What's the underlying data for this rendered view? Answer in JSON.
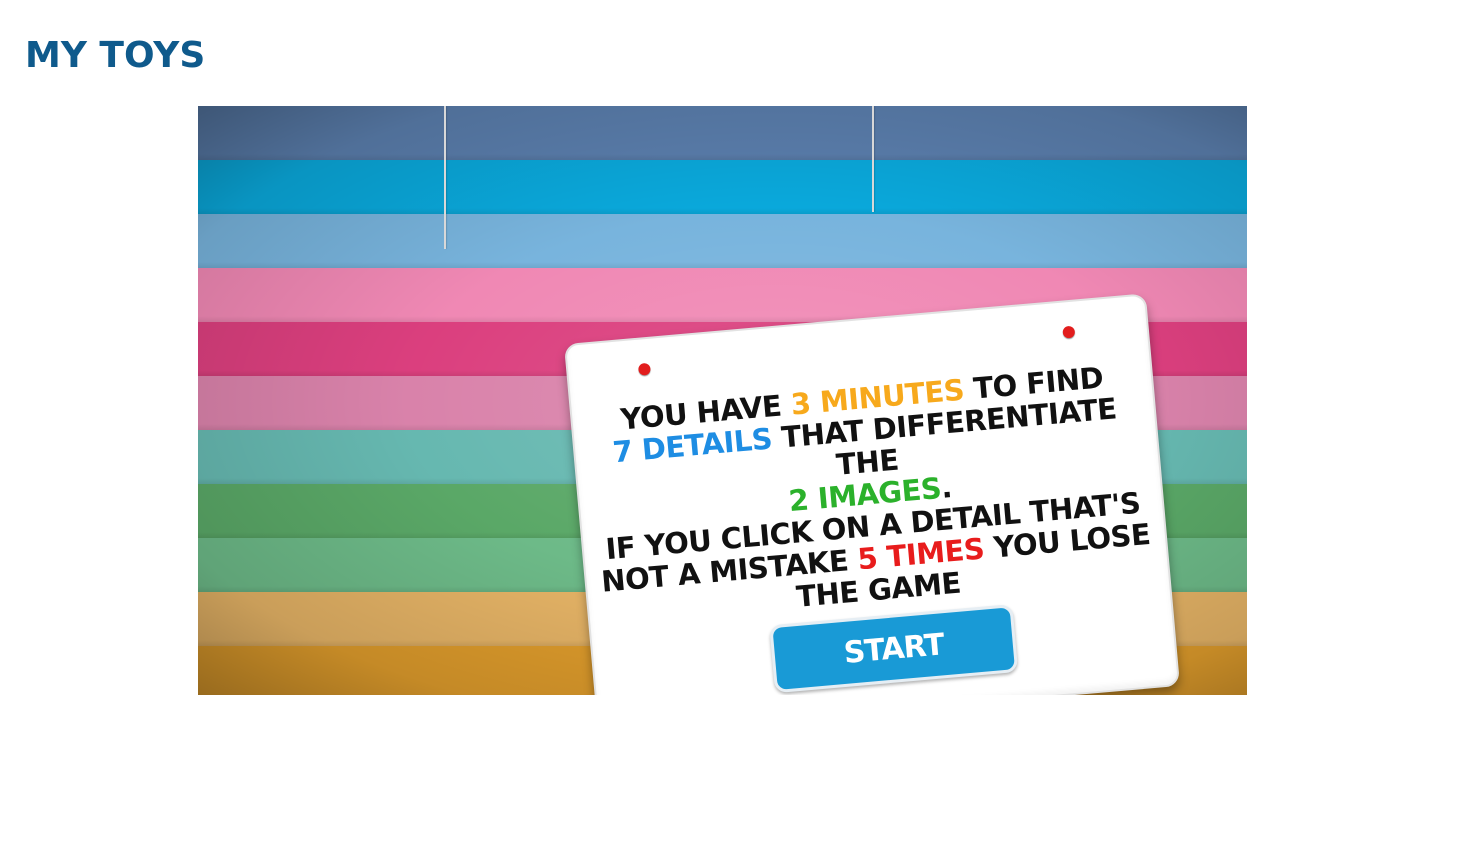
{
  "page": {
    "title": "MY TOYS",
    "title_color": "#0f5a8c"
  },
  "game": {
    "background_stripes": [
      "#5b7fae",
      "#0aa9dc",
      "#78b4dd",
      "#f088b4",
      "#db3f7e",
      "#d982aa",
      "#66b8b0",
      "#5aa867",
      "#6dba88",
      "#e6b466",
      "#e09d2c"
    ],
    "instructions": {
      "line1_prefix": "YOU HAVE ",
      "minutes": "3 MINUTES",
      "line1_suffix": " TO FIND",
      "details": "7 DETAILS",
      "line2_suffix": " THAT DIFFERENTIATE THE",
      "images": "2 IMAGES",
      "line3_suffix": ".",
      "line4": "IF YOU CLICK ON A DETAIL THAT'S",
      "line5_prefix": "NOT A MISTAKE ",
      "times": "5 TIMES",
      "line5_suffix": " YOU LOSE",
      "line6": "THE GAME"
    },
    "highlight_colors": {
      "minutes": "#f7a91c",
      "details": "#1e8de3",
      "images": "#2bb12b",
      "times": "#e81c1c"
    },
    "start_button_label": "START",
    "start_button_color": "#199ad6",
    "pin_color": "#e21d1d"
  }
}
